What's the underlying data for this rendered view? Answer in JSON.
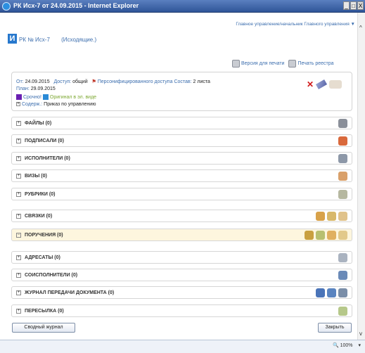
{
  "window": {
    "title": "РК Исх-7 от 24.09.2015 - Internet Explorer",
    "buttons": [
      "_",
      "□",
      "X"
    ]
  },
  "header": {
    "user": "Главное управление/начальник Главного управления ▼",
    "logo_letter": "И",
    "doc_title": "РК № Исх-7",
    "doc_subtitle": "(Исходящие.)",
    "print_version": "Версия для печати",
    "print_registry": "Печать реестра"
  },
  "info": {
    "from_label": "От:",
    "from_value": "24.09.2015",
    "access_label": "Доступ:",
    "access_value": "общий",
    "personal_access": "Персонифицированного доступа",
    "composition_label": "Состав:",
    "composition_value": "2 листа",
    "plan_label": "План:",
    "plan_value": "29.09.2015",
    "urgent": "Срочно!",
    "original": "Оригинал в эл. виде",
    "content_label": "Содерж.:",
    "content_value": "Приказ по управлению"
  },
  "sections": [
    {
      "label": "ФАЙЛЫ (0)",
      "icon": "paperclip-icon",
      "highlight": false,
      "icons": [
        "#8a8f99"
      ]
    },
    {
      "label": "ПОДПИСАЛИ (0)",
      "icon": "signature-icon",
      "highlight": false,
      "icons": [
        "#d9693c"
      ]
    },
    {
      "label": "ИСПОЛНИТЕЛИ (0)",
      "icon": "executors-icon",
      "highlight": false,
      "icons": [
        "#8d98a8"
      ]
    },
    {
      "label": "ВИЗЫ (0)",
      "icon": "visa-icon",
      "highlight": false,
      "icons": [
        "#d9a06a"
      ]
    },
    {
      "label": "РУБРИКИ (0)",
      "icon": "rubrics-icon",
      "highlight": false,
      "icons": [
        "#b6b8a0"
      ]
    },
    {
      "label": "СВЯЗКИ (0)",
      "icon": "links-icon",
      "highlight": false,
      "icons": [
        "#d8a24a",
        "#d8b86a",
        "#e0c28a"
      ]
    },
    {
      "label": "ПОРУЧЕНИЯ (0)",
      "icon": "assignments-icon",
      "highlight": true,
      "icons": [
        "#c9a040",
        "#b8c070",
        "#e0b060",
        "#e2c98a"
      ]
    },
    {
      "label": "АДРЕСАТЫ (0)",
      "icon": "addressees-icon",
      "highlight": false,
      "icons": [
        "#aab3c0"
      ]
    },
    {
      "label": "СОИСПОЛНИТЕЛИ (0)",
      "icon": "coexecutors-icon",
      "highlight": false,
      "icons": [
        "#6a8ab8"
      ]
    },
    {
      "label": "ЖУРНАЛ ПЕРЕДАЧИ ДОКУМЕНТА (0)",
      "icon": "journal-icon",
      "highlight": false,
      "icons": [
        "#4a74b8",
        "#5a84c0",
        "#7a8ea8"
      ]
    },
    {
      "label": "ПЕРЕСЫЛКА (0)",
      "icon": "forward-icon",
      "highlight": false,
      "icons": [
        "#b6c88a"
      ]
    }
  ],
  "footer": {
    "summary_journal": "Сводный журнал",
    "close": "Закрыть"
  },
  "status": {
    "zoom": "100%"
  }
}
